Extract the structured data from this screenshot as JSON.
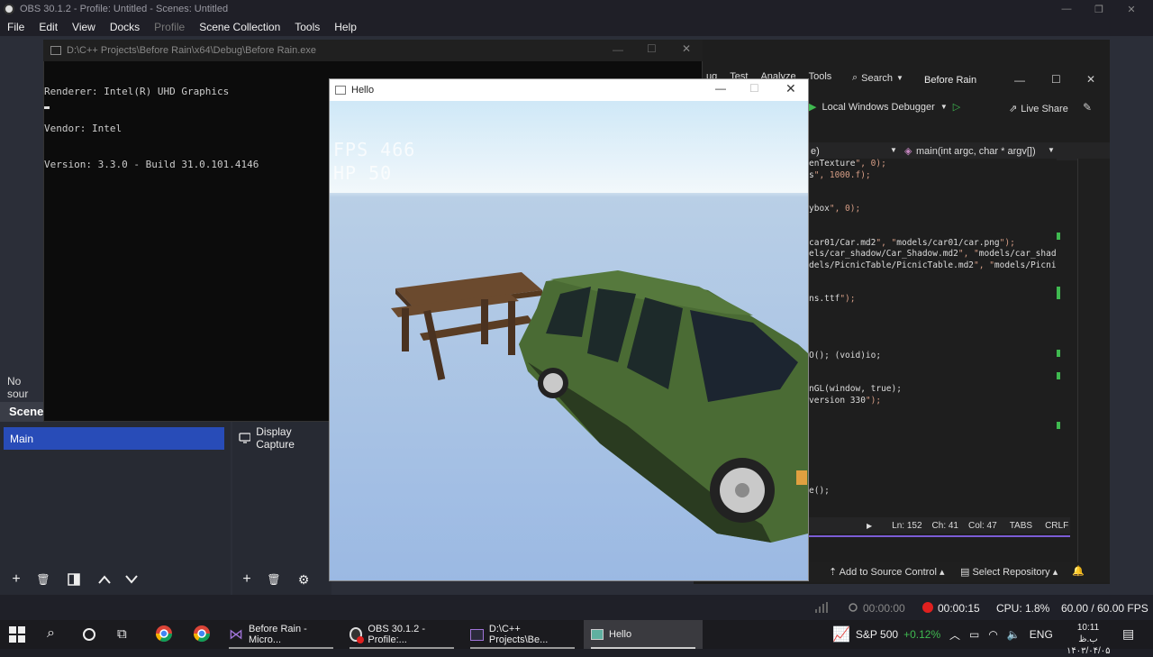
{
  "obs": {
    "title": "OBS 30.1.2 - Profile: Untitled - Scenes: Untitled",
    "menu": [
      "File",
      "Edit",
      "View",
      "Docks",
      "Profile",
      "Scene Collection",
      "Tools",
      "Help"
    ],
    "no_source": "No sour",
    "scenes_header": "Scenes",
    "scenes": [
      "Main"
    ],
    "source": "Display Capture",
    "status": {
      "stream_time": "00:00:00",
      "rec_time": "00:00:15",
      "cpu": "CPU: 1.8%",
      "fps": "60.00 / 60.00 FPS"
    }
  },
  "console": {
    "title": "D:\\C++ Projects\\Before Rain\\x64\\Debug\\Before Rain.exe",
    "lines": [
      "Renderer: Intel(R) UHD Graphics",
      "Vendor: Intel",
      "Version: 3.3.0 - Build 31.0.101.4146"
    ]
  },
  "vs": {
    "menu": [
      "ug",
      "Test",
      "Analyze",
      "Tools"
    ],
    "search": "Search",
    "project": "Before Rain",
    "debugger": "Local Windows Debugger",
    "live_share": "Live Share",
    "nav_scope": "e)",
    "nav_function": "main(int argc, char * argv[])",
    "code_lines": [
      "enTexture\", 0);",
      "s\", 1000.f);",
      "",
      "",
      "ybox\", 0);",
      "",
      "",
      "car01/Car.md2\", \"models/car01/car.png\");",
      "els/car_shadow/Car_Shadow.md2\", \"models/car_shado",
      "dels/PicnicTable/PicnicTable.md2\", \"models/Picnic",
      "",
      "",
      "ns.ttf\");",
      "",
      "",
      "",
      "",
      "O(); (void)io;",
      "",
      "",
      "nGL(window, true);",
      "version 330\");",
      "",
      "",
      "",
      "",
      "",
      "",
      "",
      "e();"
    ],
    "status": {
      "line": "Ln: 152",
      "char": "Ch: 41",
      "col": "Col: 47",
      "tabs": "TABS",
      "eol": "CRLF"
    },
    "add_source_control": "Add to Source Control",
    "select_repository": "Select Repository"
  },
  "hello": {
    "title": "Hello",
    "fps": "FPS 466",
    "hp": "HP 50"
  },
  "taskbar": {
    "apps": [
      {
        "label": "Before Rain - Micro..."
      },
      {
        "label": "OBS 30.1.2 - Profile:..."
      },
      {
        "label": "D:\\C++ Projects\\Be..."
      },
      {
        "label": "Hello"
      }
    ],
    "stock_name": "S&P 500",
    "stock_change": "+0.12%",
    "lang": "ENG",
    "time": "10:11 ب.ظ",
    "date": "۱۴۰۳/۰۴/۰۵"
  },
  "colors": {
    "obs_scene_selected": "#284cb8",
    "car_green": "#4a6b34",
    "stock_green": "#3fb950"
  }
}
